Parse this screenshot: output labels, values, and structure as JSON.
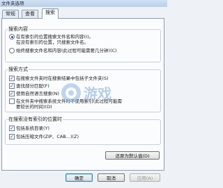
{
  "window": {
    "title": "文件夹选项"
  },
  "tabs": [
    {
      "label": "常规"
    },
    {
      "label": "查看"
    },
    {
      "label": "搜索"
    }
  ],
  "search_content": {
    "title": "搜索内容",
    "option1_line1": "在有索引的位置搜索文件名和内容(I)。",
    "option1_line2": "在没有索引的位置，只搜索文件名。",
    "option2": "始终搜索文件名和内容(此过程可能需要几分钟)(C)"
  },
  "search_method": {
    "title": "搜索方式",
    "opt1": "在搜索文件夹时在搜索结果中包括子文件夹(S)",
    "opt2": "查找部分匹配(F)",
    "opt3": "使用自然语言搜索(N)",
    "opt4_line1": "在文件夹中搜索系统文件时不使用索引(此过程可能需",
    "opt4_line2": "要较长的时间)(D)"
  },
  "no_index": {
    "title": "在搜索没有索引的位置时",
    "opt1": "包括系统目录(Y)",
    "opt2": "包括压缩文件(ZIP、CAB...)(Z)"
  },
  "buttons": {
    "restore": "还原为默认值(D)",
    "ok": "确定",
    "cancel": "取消",
    "apply": "应用(A)"
  },
  "watermark": {
    "text": "游戏"
  }
}
